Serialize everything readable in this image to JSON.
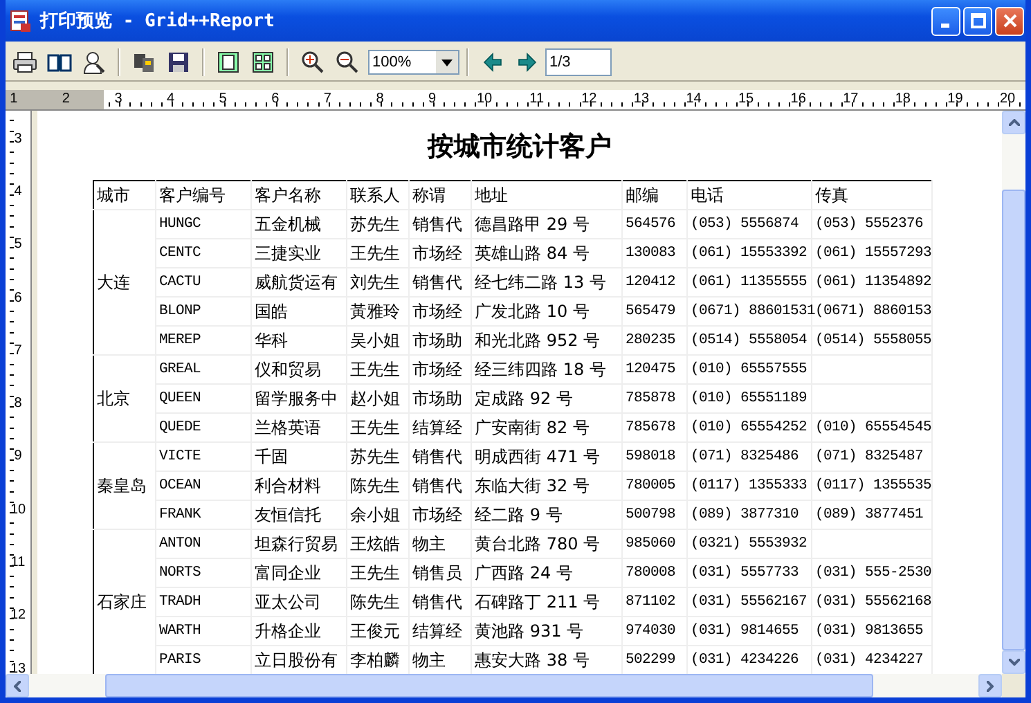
{
  "window": {
    "title": "打印预览 - Grid++Report"
  },
  "toolbar": {
    "zoom": "100%",
    "page": "1/3"
  },
  "ruler": {
    "horizontal": [
      "1",
      "2",
      "3",
      "4",
      "5",
      "6",
      "7",
      "8",
      "9",
      "10",
      "11",
      "12",
      "13",
      "14",
      "15",
      "16",
      "17",
      "18",
      "19",
      "20"
    ],
    "vertical": [
      "3",
      "4",
      "5",
      "6",
      "7",
      "8",
      "9",
      "10",
      "11",
      "12",
      "13"
    ]
  },
  "report": {
    "title": "按城市统计客户",
    "columns": [
      "城市",
      "客户编号",
      "客户名称",
      "联系人",
      "称谓",
      "地址",
      "邮编",
      "电话",
      "传真"
    ],
    "groups": [
      {
        "city": "大连",
        "rows": [
          {
            "id": "HUNGC",
            "name": "五金机械",
            "contact": "苏先生",
            "title": "销售代",
            "address": "德昌路甲 29 号",
            "zip": "564576",
            "phone": "(053) 5556874",
            "fax": "(053) 5552376"
          },
          {
            "id": "CENTC",
            "name": "三捷实业",
            "contact": "王先生",
            "title": "市场经",
            "address": "英雄山路 84 号",
            "zip": "130083",
            "phone": "(061) 15553392",
            "fax": "(061) 15557293"
          },
          {
            "id": "CACTU",
            "name": "威航货运有",
            "contact": "刘先生",
            "title": "销售代",
            "address": "经七纬二路 13 号",
            "zip": "120412",
            "phone": "(061) 11355555",
            "fax": "(061) 11354892"
          },
          {
            "id": "BLONP",
            "name": "国皓",
            "contact": "黃雅玲",
            "title": "市场经",
            "address": "广发北路 10 号",
            "zip": "565479",
            "phone": "(0671) 88601531",
            "fax": "(0671) 8860153"
          },
          {
            "id": "MEREP",
            "name": "华科",
            "contact": "吴小姐",
            "title": "市场助",
            "address": "和光北路 952 号",
            "zip": "280235",
            "phone": "(0514) 5558054",
            "fax": "(0514) 5558055"
          }
        ]
      },
      {
        "city": "北京",
        "rows": [
          {
            "id": "GREAL",
            "name": "仪和贸易",
            "contact": "王先生",
            "title": "市场经",
            "address": "经三纬四路 18 号",
            "zip": "120475",
            "phone": "(010) 65557555"
          },
          {
            "id": "QUEEN",
            "name": "留学服务中",
            "contact": "赵小姐",
            "title": "市场助",
            "address": "定成路 92 号",
            "zip": "785878",
            "phone": "(010) 65551189"
          },
          {
            "id": "QUEDE",
            "name": "兰格英语",
            "contact": "王先生",
            "title": "结算经",
            "address": "广安南街 82 号",
            "zip": "785678",
            "phone": "(010) 65554252",
            "fax": "(010) 65554545"
          }
        ]
      },
      {
        "city": "秦皇岛",
        "rows": [
          {
            "id": "VICTE",
            "name": "千固",
            "contact": "苏先生",
            "title": "销售代",
            "address": "明成西街 471 号",
            "zip": "598018",
            "phone": "(071) 8325486",
            "fax": "(071) 8325487"
          },
          {
            "id": "OCEAN",
            "name": "利合材料",
            "contact": "陈先生",
            "title": "销售代",
            "address": "东临大街 32 号",
            "zip": "780005",
            "phone": "(0117) 1355333",
            "fax": "(0117) 1355535"
          },
          {
            "id": "FRANK",
            "name": "友恒信托",
            "contact": "余小姐",
            "title": "市场经",
            "address": "经二路 9 号",
            "zip": "500798",
            "phone": "(089) 3877310",
            "fax": "(089) 3877451"
          }
        ]
      },
      {
        "city": "石家庄",
        "rows": [
          {
            "id": "ANTON",
            "name": "坦森行贸易",
            "contact": "王炫皓",
            "title": "物主",
            "address": "黄台北路 780 号",
            "zip": "985060",
            "phone": "(0321) 5553932"
          },
          {
            "id": "NORTS",
            "name": "富同企业",
            "contact": "王先生",
            "title": "销售员",
            "address": "广西路 24 号",
            "zip": "780008",
            "phone": "(031) 5557733",
            "fax": "(031) 555-2530"
          },
          {
            "id": "TRADH",
            "name": "亚太公司",
            "contact": "陈先生",
            "title": "销售代",
            "address": "石碑路丁 211 号",
            "zip": "871102",
            "phone": "(031) 55562167",
            "fax": "(031) 55562168"
          },
          {
            "id": "WARTH",
            "name": "升格企业",
            "contact": "王俊元",
            "title": "结算经",
            "address": "黄池路 931 号",
            "zip": "974030",
            "phone": "(031) 9814655",
            "fax": "(031) 9813655"
          },
          {
            "id": "PARIS",
            "name": "立日股份有",
            "contact": "李柏麟",
            "title": "物主",
            "address": "惠安大路 38 号",
            "zip": "502299",
            "phone": "(031) 4234226",
            "fax": "(031) 4234227"
          }
        ]
      }
    ]
  }
}
